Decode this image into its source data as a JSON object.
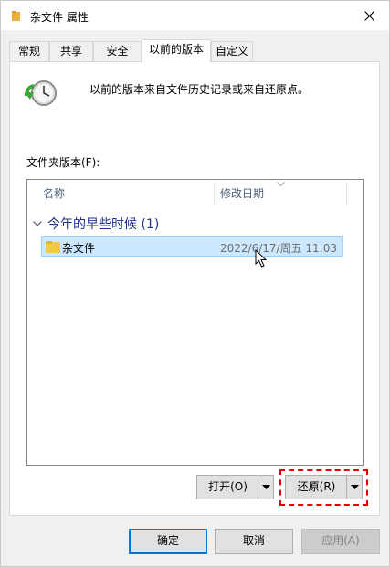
{
  "window": {
    "title": "杂文件 属性"
  },
  "tabs": [
    {
      "label": "常规"
    },
    {
      "label": "共享"
    },
    {
      "label": "安全"
    },
    {
      "label": "以前的版本"
    },
    {
      "label": "自定义"
    }
  ],
  "description": "以前的版本来自文件历史记录或来自还原点。",
  "list": {
    "label": "文件夹版本(F):",
    "columns": [
      {
        "label": "名称"
      },
      {
        "label": "修改日期"
      }
    ],
    "group": {
      "label": "今年的早些时候 (1)"
    },
    "rows": [
      {
        "name": "杂文件",
        "date": "2022/6/17/周五 11:03"
      }
    ]
  },
  "buttons": {
    "open": "打开(O)",
    "restore": "还原(R)",
    "ok": "确定",
    "cancel": "取消",
    "apply": "应用(A)"
  },
  "colors": {
    "selection": "#cce8ff",
    "highlight_dashed": "#e00000",
    "group_text": "#1e3287"
  }
}
